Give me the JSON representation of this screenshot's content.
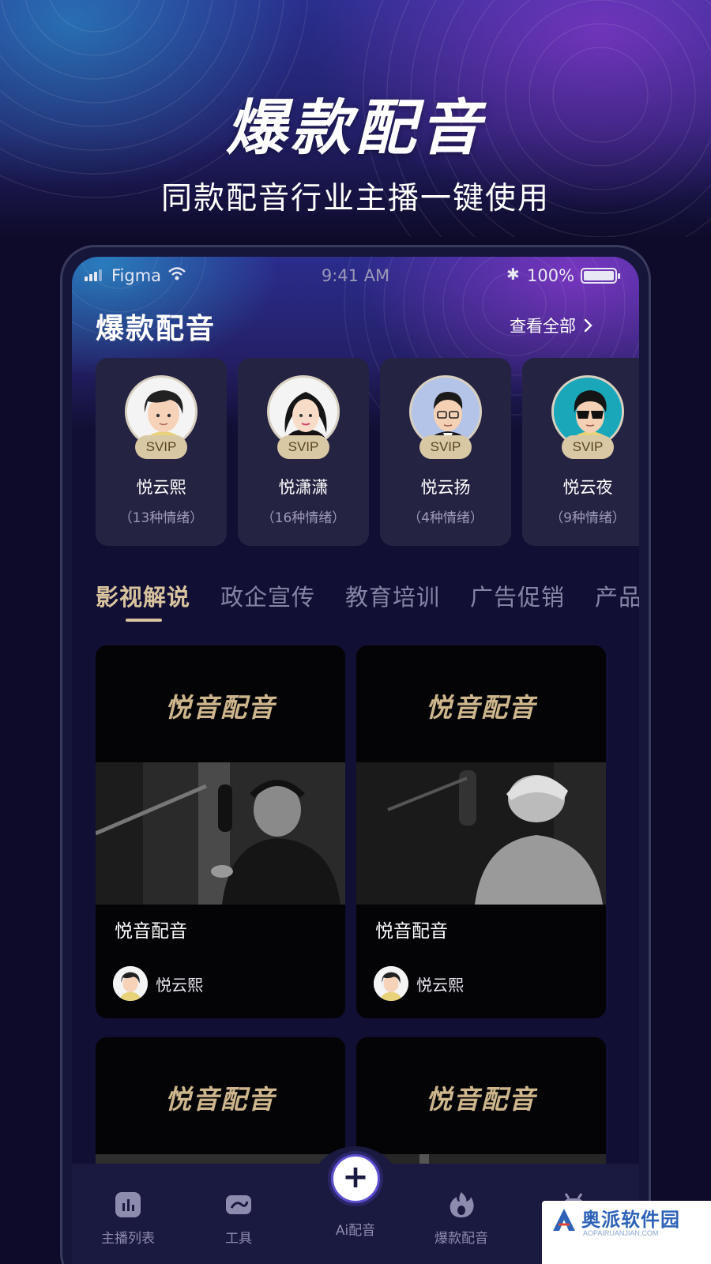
{
  "hero": {
    "title": "爆款配音",
    "subtitle": "同款配音行业主播一键使用"
  },
  "status_bar": {
    "carrier": "Figma",
    "time": "9:41 AM",
    "battery": "100%",
    "battery_level": 1.0
  },
  "section": {
    "title": "爆款配音",
    "see_all": "查看全部"
  },
  "anchors": [
    {
      "name": "悦云熙",
      "badge": "SVIP",
      "mood": "（13种情绪）"
    },
    {
      "name": "悦潇潇",
      "badge": "SVIP",
      "mood": "（16种情绪）"
    },
    {
      "name": "悦云扬",
      "badge": "SVIP",
      "mood": "（4种情绪）"
    },
    {
      "name": "悦云夜",
      "badge": "SVIP",
      "mood": "（9种情绪）"
    }
  ],
  "tabs": [
    {
      "label": "影视解说",
      "active": true
    },
    {
      "label": "政企宣传",
      "active": false
    },
    {
      "label": "教育培训",
      "active": false
    },
    {
      "label": "广告促销",
      "active": false
    },
    {
      "label": "产品",
      "active": false
    }
  ],
  "cards": [
    {
      "brand": "悦音配音",
      "title": "悦音配音",
      "author": "悦云熙"
    },
    {
      "brand": "悦音配音",
      "title": "悦音配音",
      "author": "悦云熙"
    },
    {
      "brand": "悦音配音"
    },
    {
      "brand": "悦音配音"
    }
  ],
  "nav": {
    "items": [
      {
        "label": "主播列表",
        "icon": "chart-icon"
      },
      {
        "label": "工具",
        "icon": "tool-icon"
      },
      {
        "label": "Ai配音",
        "icon": "plus-icon"
      },
      {
        "label": "爆款配音",
        "icon": "flame-icon"
      },
      {
        "label": "",
        "icon": "robot-icon"
      }
    ]
  },
  "watermark": {
    "text": "奥派软件园",
    "url": "AOPAIRUANJIAN.COM"
  },
  "colors": {
    "accent_gold": "#d8c39e",
    "background": "#110f33",
    "card_bg": "#252342"
  }
}
